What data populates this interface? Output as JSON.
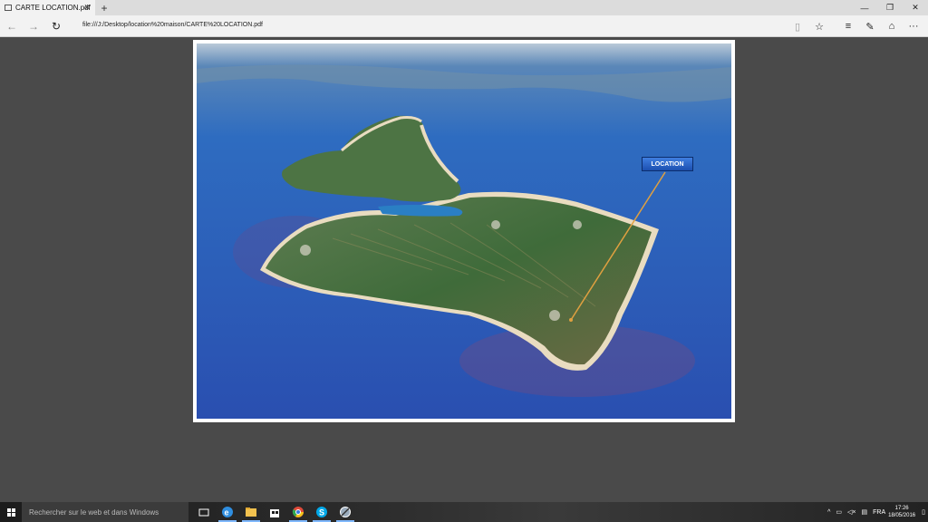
{
  "browser": {
    "tab": {
      "title": "CARTE LOCATION.pdf",
      "close": "✕"
    },
    "new_tab": "+",
    "window_controls": {
      "minimize": "—",
      "restore": "❐",
      "close": "✕"
    },
    "nav": {
      "back": "←",
      "forward": "→",
      "refresh": "↻"
    },
    "url": "file:///J:/Desktop/location%20maison/CARTE%20LOCATION.pdf",
    "tools": {
      "reading": "▯",
      "favorite": "☆",
      "hub": "≡",
      "note": "✎",
      "share": "⌂",
      "more": "···"
    }
  },
  "document": {
    "location_label": "LOCATION"
  },
  "taskbar": {
    "search_placeholder": "Rechercher sur le web et dans Windows",
    "language": "FRA",
    "time": "17:26",
    "date": "18/05/2016",
    "tray_up": "^"
  },
  "colors": {
    "sea": "#2a62b6",
    "land": "#3f6b3a",
    "beach": "#e9dcc0",
    "label_bg": "#2a62cc",
    "pointer_line": "#e0a040"
  }
}
